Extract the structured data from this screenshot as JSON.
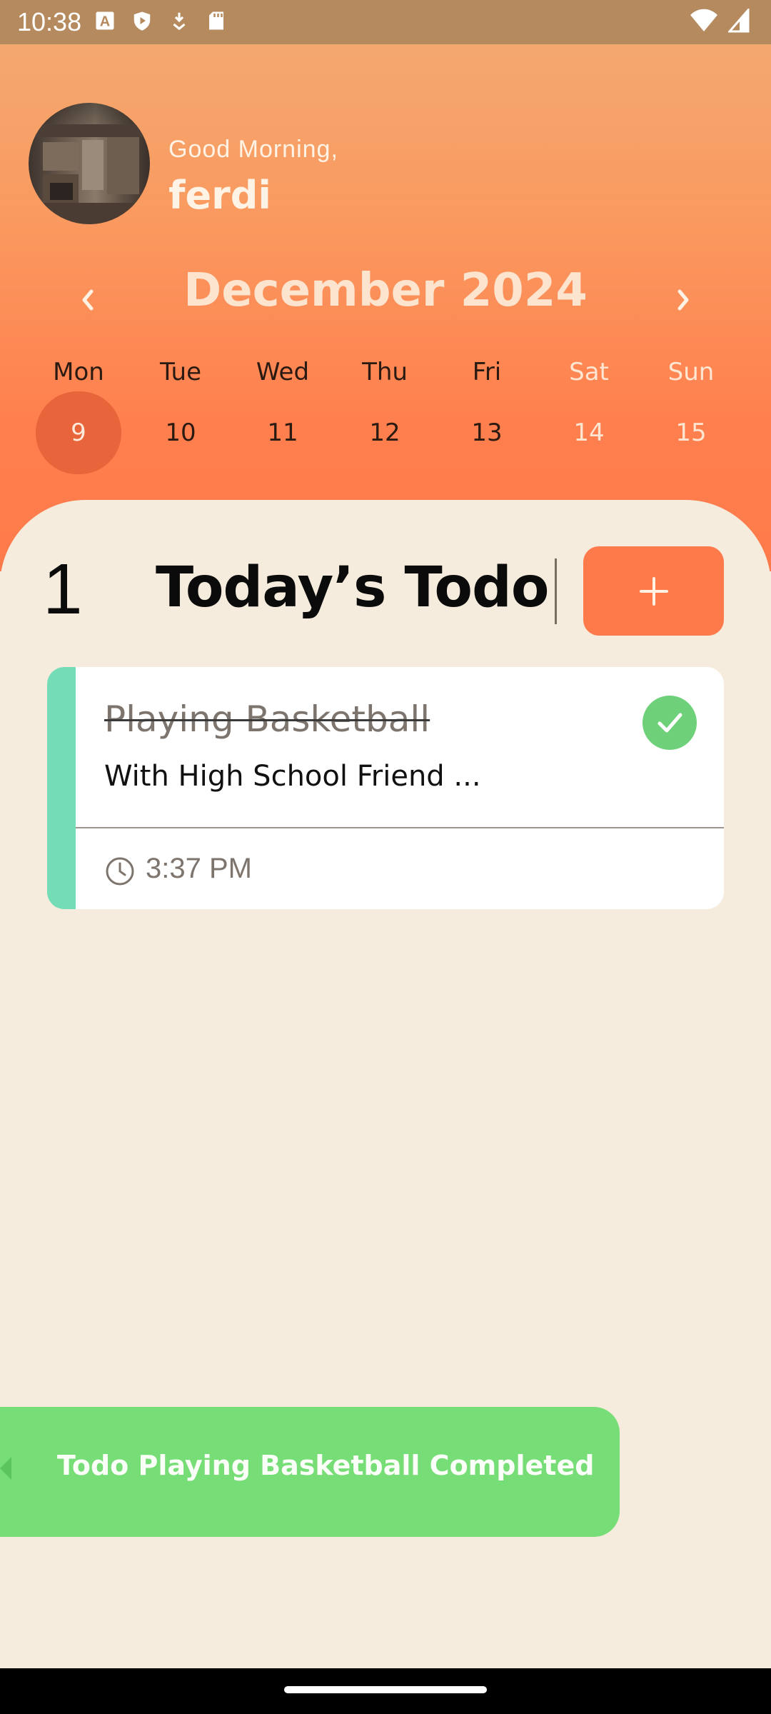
{
  "status_bar": {
    "time": "10:38",
    "left_icons": [
      "font-icon",
      "shield-icon",
      "download-icon",
      "sd-card-icon"
    ],
    "right_icons": [
      "wifi-icon",
      "signal-icon"
    ]
  },
  "header": {
    "greeting": "Good Morning,",
    "username": "ferdi"
  },
  "calendar": {
    "month_label": "December 2024",
    "days": [
      {
        "name": "Mon",
        "date": "9",
        "selected": true,
        "weekend": false
      },
      {
        "name": "Tue",
        "date": "10",
        "selected": false,
        "weekend": false
      },
      {
        "name": "Wed",
        "date": "11",
        "selected": false,
        "weekend": false
      },
      {
        "name": "Thu",
        "date": "12",
        "selected": false,
        "weekend": false
      },
      {
        "name": "Fri",
        "date": "13",
        "selected": false,
        "weekend": false
      },
      {
        "name": "Sat",
        "date": "14",
        "selected": false,
        "weekend": true
      },
      {
        "name": "Sun",
        "date": "15",
        "selected": false,
        "weekend": true
      }
    ]
  },
  "todos": {
    "count": "1",
    "heading": "Today’s Todo",
    "add_label": "+",
    "items": [
      {
        "title": "Playing Basketball",
        "subtitle": "With High School Friend ...",
        "time": "3:37 PM",
        "completed": true,
        "accent_color": "#74DDB8"
      }
    ]
  },
  "snackbar": {
    "message": "Todo Playing Basketball Completed"
  },
  "colors": {
    "accent": "#FF7A4A",
    "success": "#77DD77",
    "background": "#F5ECDD"
  }
}
